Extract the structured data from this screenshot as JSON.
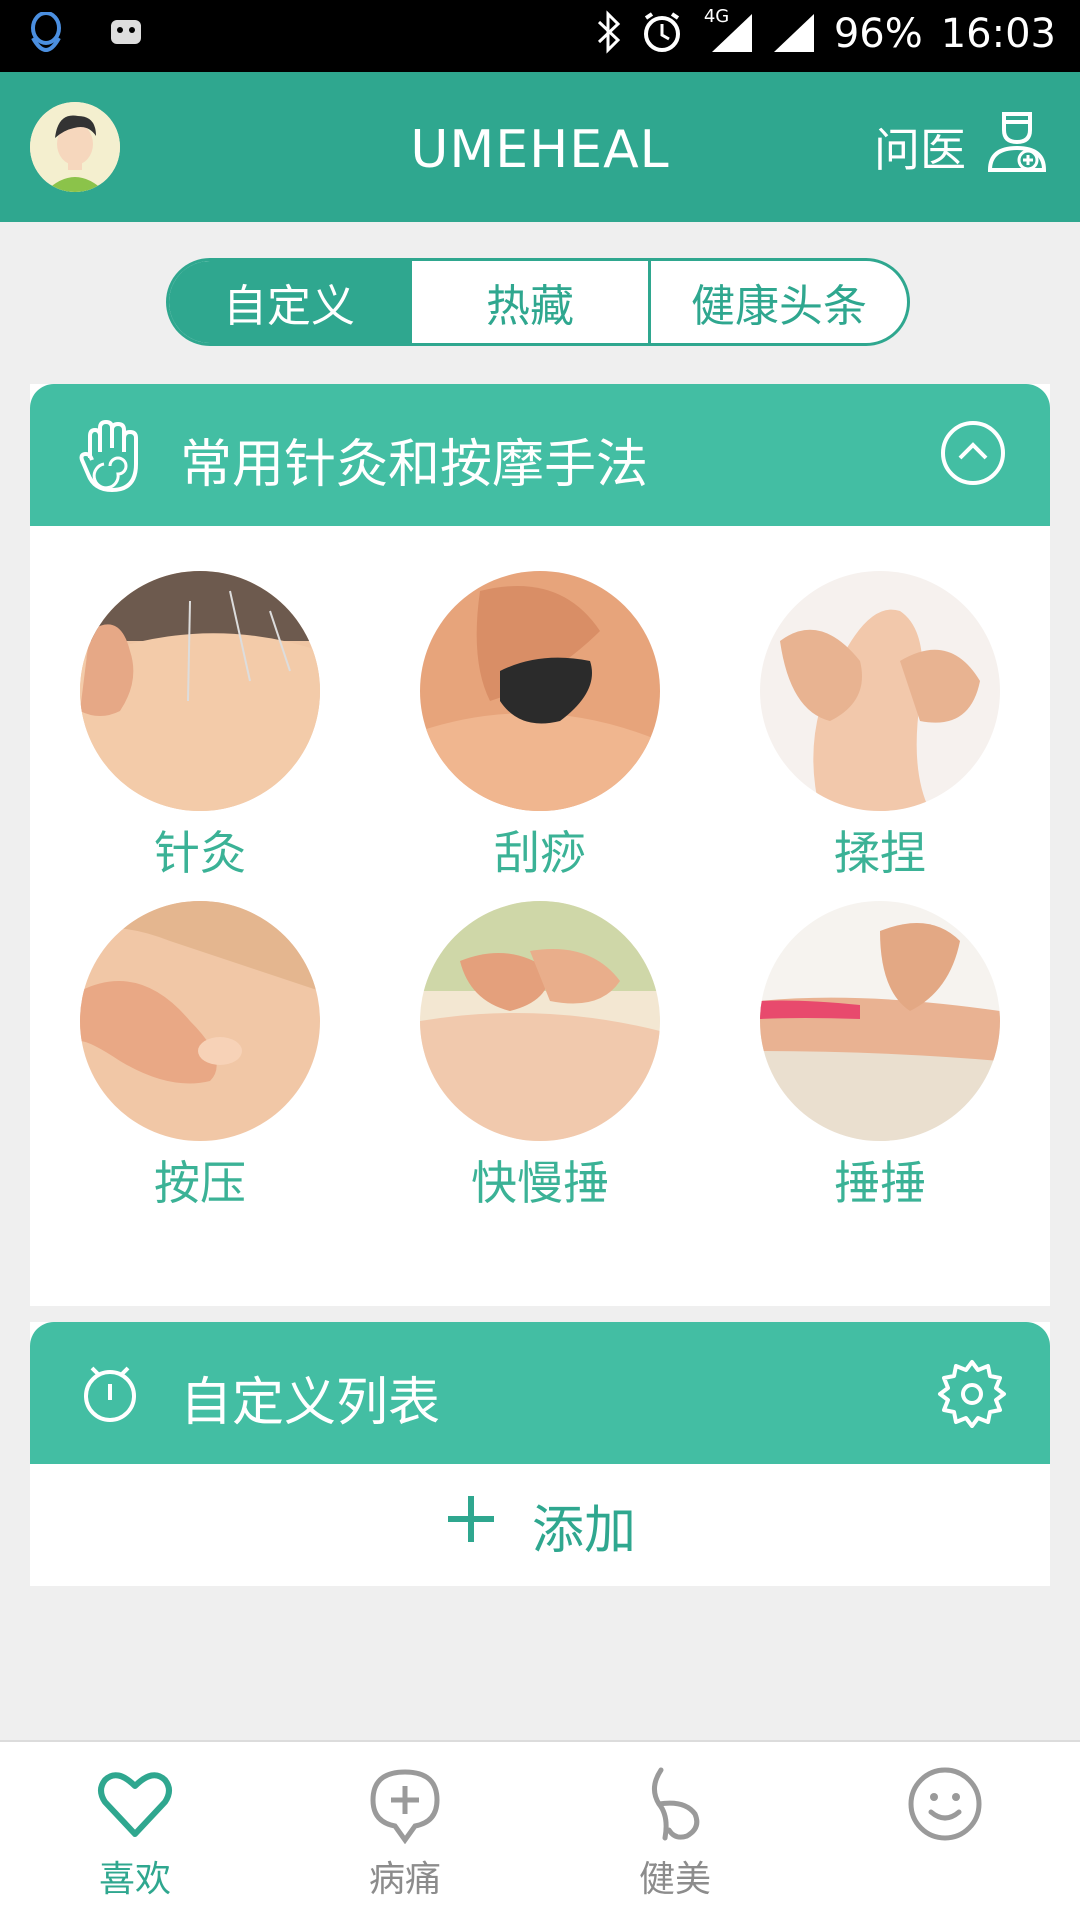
{
  "status_bar": {
    "battery": "96%",
    "time": "16:03",
    "network": "4G",
    "icons": [
      "qq-icon",
      "android-icon",
      "bluetooth-icon",
      "alarm-icon",
      "signal-icon",
      "signal-icon"
    ]
  },
  "app_bar": {
    "title": "UMEHEAL",
    "ask_doctor_label": "问医"
  },
  "tabs": [
    {
      "label": "自定义",
      "active": true
    },
    {
      "label": "热藏",
      "active": false
    },
    {
      "label": "健康头条",
      "active": false
    }
  ],
  "techniques_card": {
    "title": "常用针灸和按摩手法",
    "items": [
      {
        "label": "针灸"
      },
      {
        "label": "刮痧"
      },
      {
        "label": "揉捏"
      },
      {
        "label": "按压"
      },
      {
        "label": "快慢捶"
      },
      {
        "label": "捶捶"
      }
    ]
  },
  "custom_list_card": {
    "title": "自定义列表",
    "add_label": "添加"
  },
  "bottom_nav": [
    {
      "label": "喜欢",
      "icon": "heart-icon",
      "active": true
    },
    {
      "label": "病痛",
      "icon": "plus-bubble-icon",
      "active": false
    },
    {
      "label": "健美",
      "icon": "body-icon",
      "active": false
    },
    {
      "label": "",
      "icon": "smiley-icon",
      "active": false
    }
  ],
  "colors": {
    "primary": "#2fa78f",
    "card_header": "#43bea3",
    "label": "#3bb296"
  }
}
